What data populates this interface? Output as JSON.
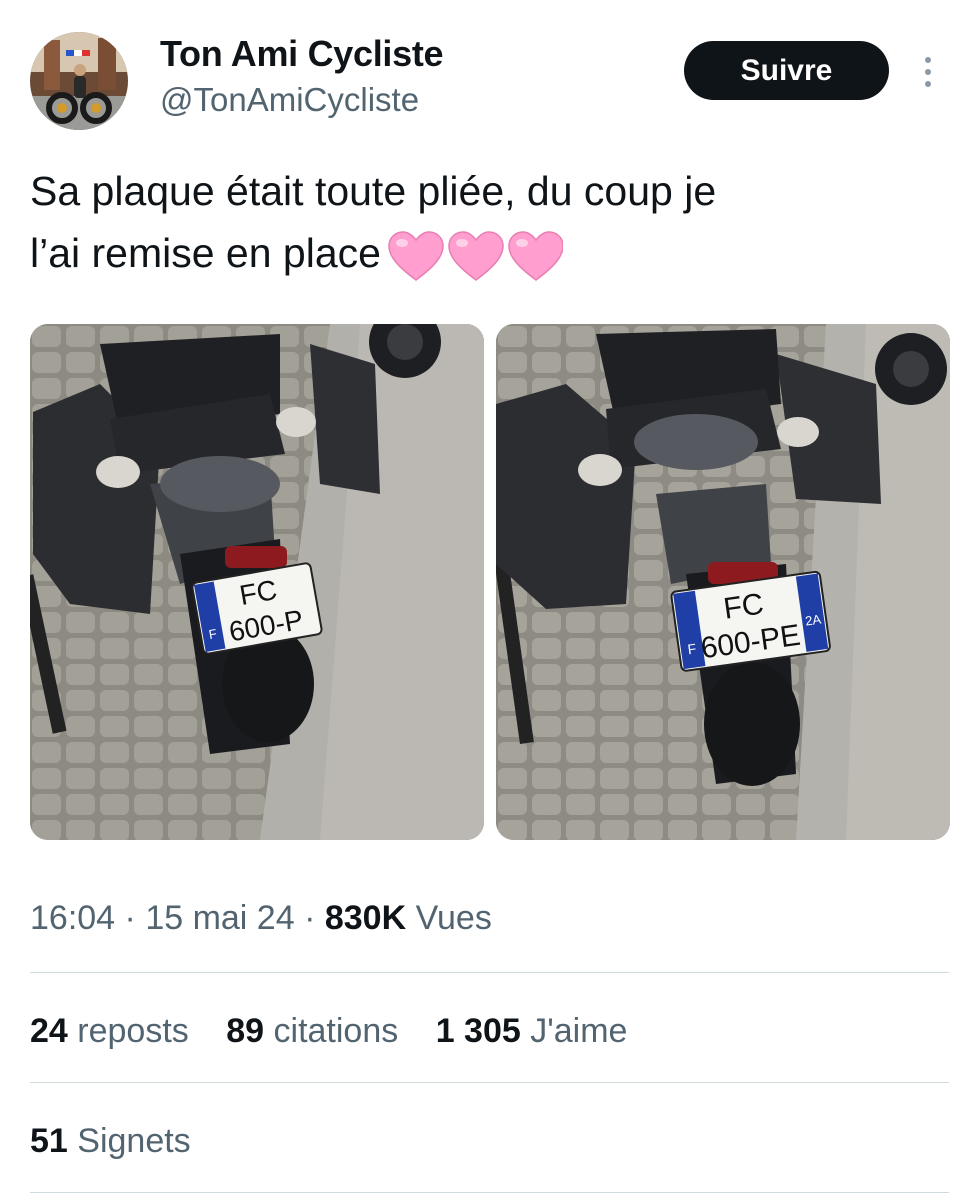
{
  "author": {
    "display_name": "Ton Ami Cycliste",
    "handle": "@TonAmiCycliste"
  },
  "follow_label": "Suivre",
  "tweet": {
    "line1": "Sa plaque était toute pliée, du coup je",
    "line2": "l’ai remise en place",
    "emoji_icon": "pink-heart-icon",
    "emoji_count": 3
  },
  "photos": [
    {
      "plate_line1": "FC",
      "plate_line2": "600-P",
      "plate_country": "F"
    },
    {
      "plate_line1": "FC",
      "plate_line2": "600-PE",
      "plate_country": "F",
      "plate_region": "2A"
    }
  ],
  "meta": {
    "time": "16:04",
    "sep1": " · ",
    "date": "15 mai 24",
    "sep2": " · ",
    "views": "830K",
    "views_label": " Vues"
  },
  "stats": {
    "reposts": "24",
    "reposts_label": " reposts",
    "quotes": "89",
    "quotes_label": " citations",
    "likes": "1 305",
    "likes_label": " J'aime",
    "bookmarks": "51",
    "bookmarks_label": " Signets"
  },
  "colors": {
    "text": "#0f1419",
    "secondary": "#536471",
    "follow_bg": "#0f1419",
    "heart": "#ff9ecf",
    "divider": "#cfd9de"
  }
}
